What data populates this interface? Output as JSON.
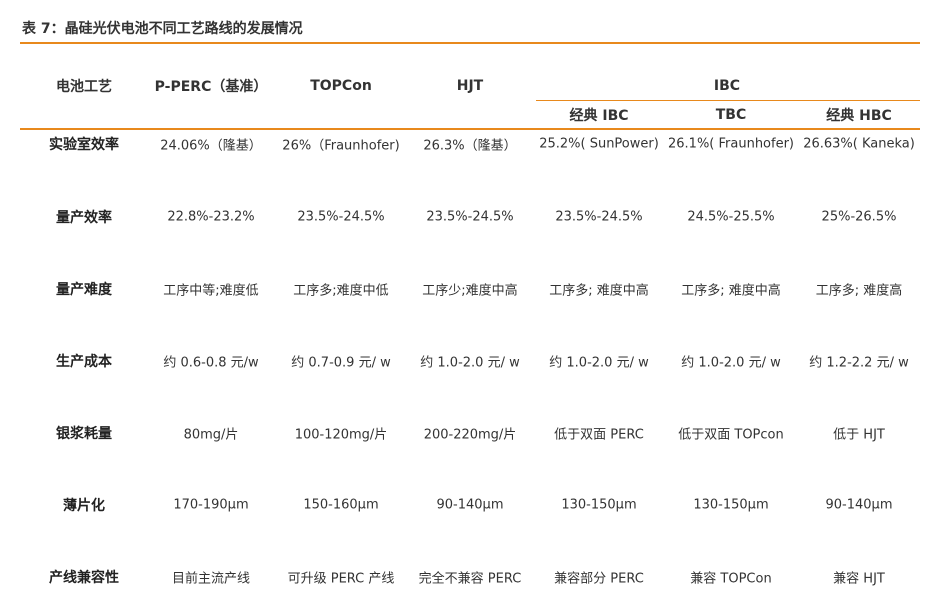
{
  "title": "表 7：晶硅光伏电池不同工艺路线的发展情况",
  "header": {
    "process_label": "电池工艺",
    "ibc_group": "IBC",
    "columns": [
      "P-PERC（基准）",
      "TOPCon",
      "HJT"
    ],
    "ibc_columns": [
      "经典 IBC",
      "TBC",
      "经典 HBC"
    ]
  },
  "rows": [
    {
      "label": "实验室效率",
      "cells": [
        "24.06%（隆基）",
        "26%（Fraunhofer)",
        "26.3%（隆基）",
        "25.2%( SunPower)",
        "26.1%( Fraunhofer)",
        "26.63%( Kaneka)"
      ]
    },
    {
      "label": "量产效率",
      "cells": [
        "22.8%-23.2%",
        "23.5%-24.5%",
        "23.5%-24.5%",
        "23.5%-24.5%",
        "24.5%-25.5%",
        "25%-26.5%"
      ]
    },
    {
      "label": "量产难度",
      "cells": [
        "工序中等;难度低",
        "工序多;难度中低",
        "工序少;难度中高",
        "工序多; 难度中高",
        "工序多; 难度中高",
        "工序多; 难度高"
      ]
    },
    {
      "label": "生产成本",
      "cells": [
        "约 0.6-0.8 元/w",
        "约 0.7-0.9 元/ w",
        "约 1.0-2.0 元/ w",
        "约 1.0-2.0 元/ w",
        "约 1.0-2.0 元/ w",
        "约 1.2-2.2 元/ w"
      ]
    },
    {
      "label": "银浆耗量",
      "cells": [
        "80mg/片",
        "100-120mg/片",
        "200-220mg/片",
        "低于双面 PERC",
        "低于双面 TOPcon",
        "低于 HJT"
      ]
    },
    {
      "label": "薄片化",
      "cells": [
        "170-190μm",
        "150-160μm",
        "90-140μm",
        "130-150μm",
        "130-150μm",
        "90-140μm"
      ]
    },
    {
      "label": "产线兼容性",
      "cells": [
        "目前主流产线",
        "可升级 PERC 产线",
        "完全不兼容 PERC",
        "兼容部分 PERC",
        "兼容 TOPCon",
        "兼容 HJT"
      ]
    }
  ],
  "colors": {
    "accent": "#E8891C",
    "text": "#222222"
  }
}
